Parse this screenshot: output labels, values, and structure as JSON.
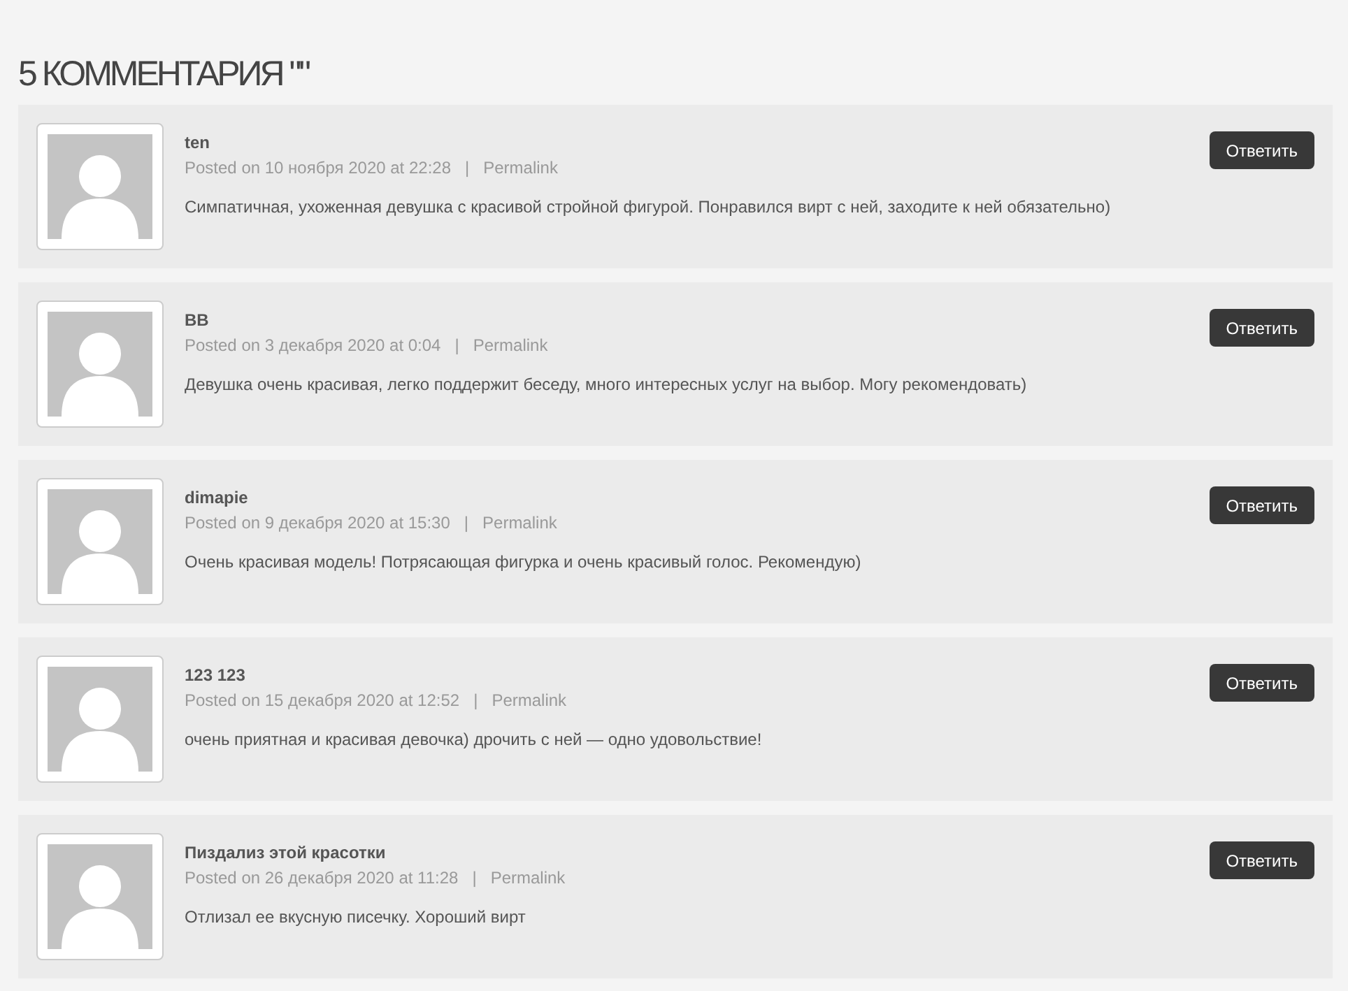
{
  "heading": "5 КОММЕНТАРИЯ \"\"",
  "comments": [
    {
      "author": "ten",
      "posted": "Posted on 10 ноября 2020 at 22:28",
      "separator": "|",
      "link": "Permalink",
      "text": "Симпатичная, ухоженная девушка с красивой стройной фигурой. Понравился вирт с ней, заходите к ней обязательно)",
      "reply": "Ответить"
    },
    {
      "author": "BB",
      "posted": "Posted on 3 декабря 2020 at 0:04",
      "separator": "|",
      "link": "Permalink",
      "text": "Девушка очень красивая, легко поддержит беседу, много интересных услуг на выбор. Могу рекомендовать)",
      "reply": "Ответить"
    },
    {
      "author": "dimapie",
      "posted": "Posted on 9 декабря 2020 at 15:30",
      "separator": "|",
      "link": "Permalink",
      "text": "Очень красивая модель! Потрясающая фигурка и очень красивый голос. Рекомендую)",
      "reply": "Ответить"
    },
    {
      "author": "123 123",
      "posted": "Posted on 15 декабря 2020 at 12:52",
      "separator": "|",
      "link": "Permalink",
      "text": "очень приятная и красивая девочка) дрочить с ней — одно удовольствие!",
      "reply": "Ответить"
    },
    {
      "author": "Пиздализ этой красотки",
      "posted": "Posted on 26 декабря 2020 at 11:28",
      "separator": "|",
      "link": "Permalink",
      "text": "Отлизал ее вкусную писечку. Хороший вирт",
      "reply": "Ответить"
    }
  ]
}
